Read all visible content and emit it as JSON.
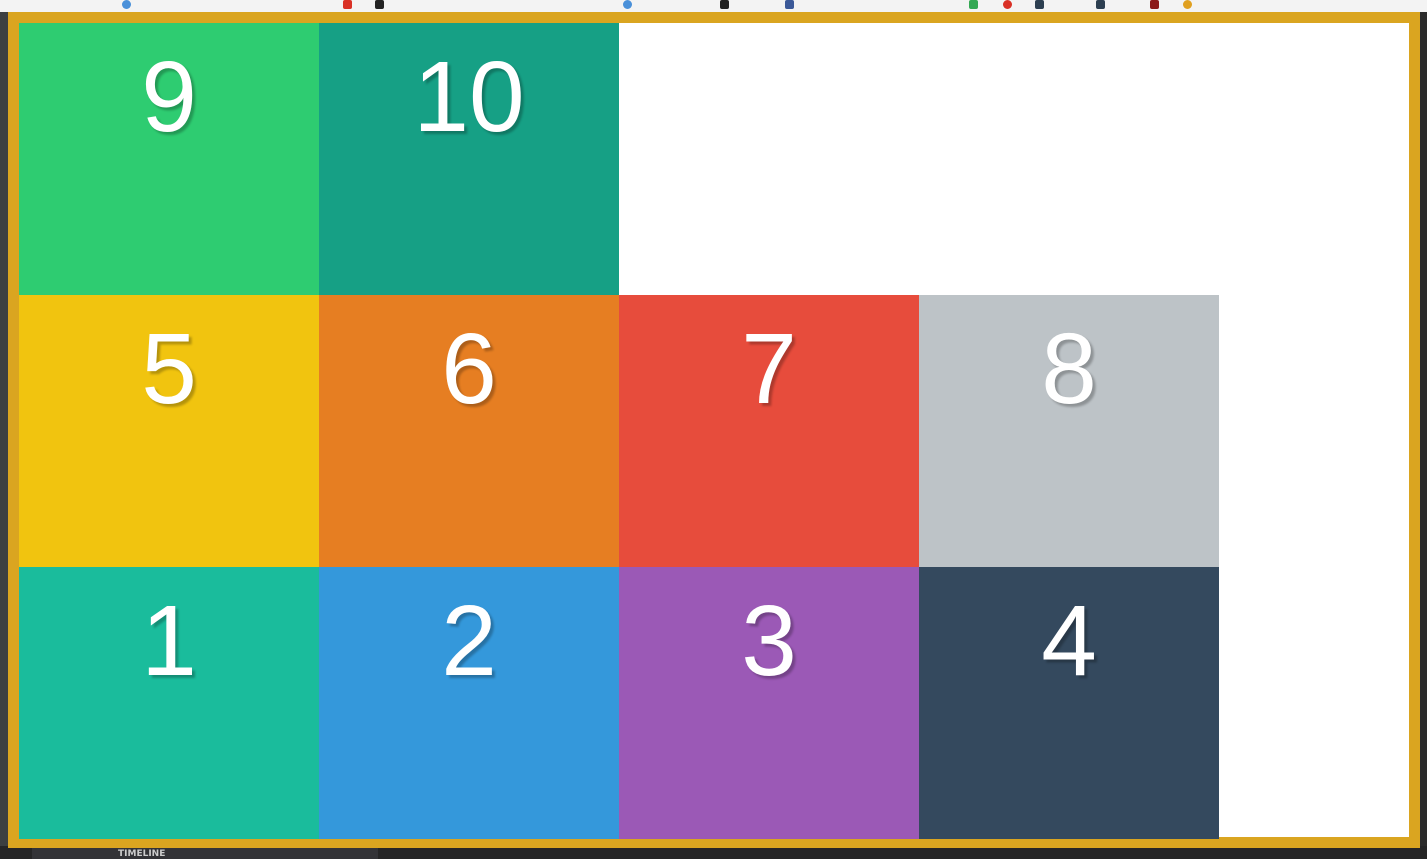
{
  "panel": {
    "timeline_label": "TIMELINE"
  },
  "colors": {
    "frame_border": "#daa520",
    "box_1": "#1abc9c",
    "box_2": "#3498db",
    "box_3": "#9b59b6",
    "box_4": "#34495e",
    "box_5": "#f1c40f",
    "box_6": "#e67e22",
    "box_7": "#e74c3c",
    "box_8": "#bdc3c7",
    "box_9": "#2ecc71",
    "box_10": "#16a085"
  },
  "boxes": [
    {
      "label": "9"
    },
    {
      "label": "10"
    },
    {
      "label": "5"
    },
    {
      "label": "6"
    },
    {
      "label": "7"
    },
    {
      "label": "8"
    },
    {
      "label": "1"
    },
    {
      "label": "2"
    },
    {
      "label": "3"
    },
    {
      "label": "4"
    }
  ]
}
